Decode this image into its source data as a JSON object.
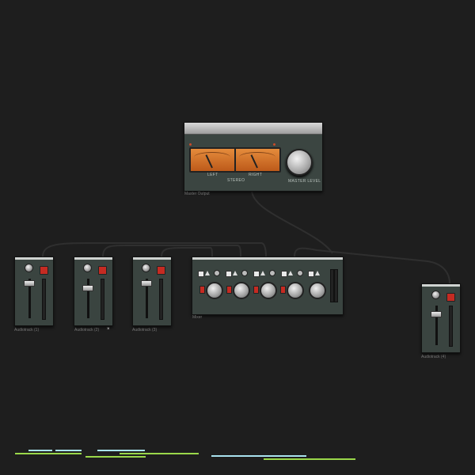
{
  "devices": {
    "master": {
      "label": "Master Output",
      "left_label": "LEFT",
      "right_label": "RIGHT",
      "stereo_label": "STEREO",
      "knob_label": "MASTER LEVEL"
    },
    "strips": [
      {
        "label": "Audiotrack (1)"
      },
      {
        "label": "Audiotrack (2)",
        "close": "×"
      },
      {
        "label": "Audiotrack (3)"
      },
      {
        "label": "Audiotrack (4)"
      }
    ],
    "mixer": {
      "label": "Mixer"
    }
  },
  "colors": {
    "background": "#1e1e1e",
    "device_body": "#3a4440",
    "accent_red": "#c52b22",
    "vu_orange": "#e58c3c",
    "cable": "#2e2e2e",
    "timeline_cyan": "#a9e3ef",
    "timeline_green": "#9ad84a"
  },
  "icons": [
    "knob-icon",
    "record-button-icon",
    "fader-icon",
    "vu-meter-icon",
    "close-icon"
  ]
}
